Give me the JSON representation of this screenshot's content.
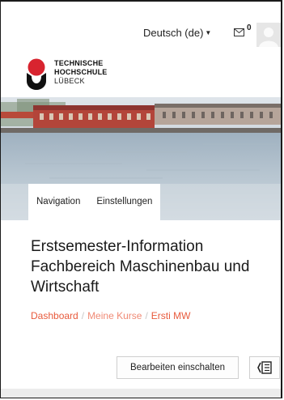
{
  "header": {
    "language_label": "Deutsch (de)",
    "message_count": "0"
  },
  "logo": {
    "line1": "TECHNISCHE",
    "line2": "HOCHSCHULE",
    "line3": "LÜBECK"
  },
  "tabs": [
    {
      "label": "Navigation"
    },
    {
      "label": "Einstellungen"
    }
  ],
  "page": {
    "title": "Erstsemester-Information Fachbereich Maschinenbau und Wirtschaft"
  },
  "breadcrumb": [
    {
      "label": "Dashboard"
    },
    {
      "label": "Meine Kurse"
    },
    {
      "label": "Ersti MW"
    }
  ],
  "toolbar": {
    "edit_label": "Bearbeiten einschalten"
  },
  "colors": {
    "accent": "#e85a3c",
    "logo_red": "#d8242f"
  },
  "icons": {
    "language_caret": "caret-down-icon",
    "messages": "envelope-icon",
    "user": "avatar",
    "drawer": "drawer-toggle-icon"
  }
}
